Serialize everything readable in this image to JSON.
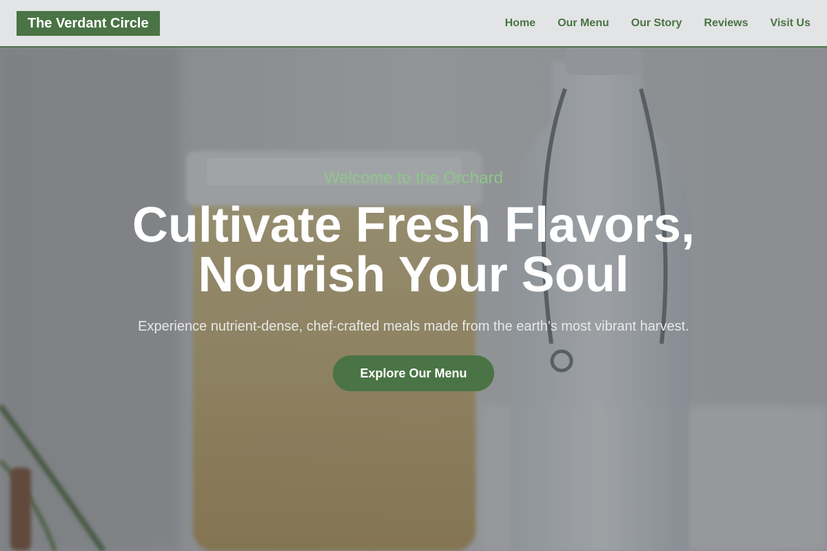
{
  "header": {
    "logo": "The Verdant Circle",
    "nav": [
      "Home",
      "Our Menu",
      "Our Story",
      "Reviews",
      "Visit Us"
    ]
  },
  "hero": {
    "eyebrow": "Welcome to the Orchard",
    "headline_line1": "Cultivate Fresh Flavors,",
    "headline_line2": "Nourish Your Soul",
    "subhead": "Experience nutrient-dense, chef-crafted meals made from the earth's most vibrant harvest.",
    "cta_label": "Explore Our Menu"
  },
  "colors": {
    "brand_green": "#4a7445",
    "eyebrow_green": "#8fc68a",
    "header_bg": "#e3e4e5"
  }
}
